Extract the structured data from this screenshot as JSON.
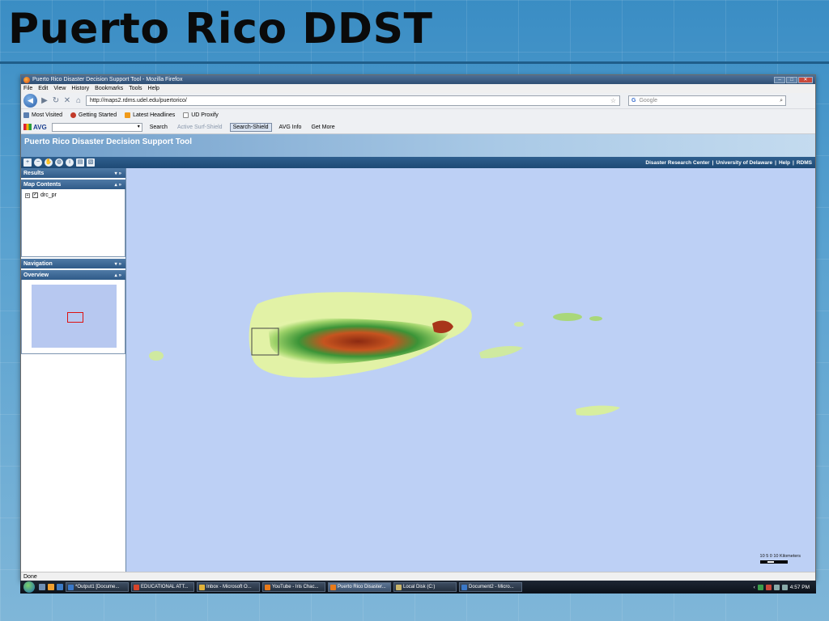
{
  "slide": {
    "title": "Puerto Rico DDST"
  },
  "browser": {
    "window_title": "Puerto Rico Disaster Decision Support Tool - Mozilla Firefox",
    "menu": [
      "File",
      "Edit",
      "View",
      "History",
      "Bookmarks",
      "Tools",
      "Help"
    ],
    "url": "http://maps2.rdms.udel.edu/puertorico/",
    "search_placeholder": "Google",
    "bookmarks": [
      "Most Visited",
      "Getting Started",
      "Latest Headlines",
      "UD Proxify"
    ],
    "avg_toolbar": {
      "logo": "AVG",
      "search_label": "Search",
      "active_surf_shield": "Active Surf-Shield",
      "search_shield": "Search-Shield",
      "avg_info": "AVG Info",
      "get_more": "Get More"
    },
    "status": "Done"
  },
  "app": {
    "title": "Puerto Rico Disaster Decision Support Tool",
    "top_links": [
      "Disaster Research Center",
      "|",
      "University of Delaware",
      "|",
      "Help",
      "|",
      "RDMS"
    ],
    "panels": {
      "results": "Results",
      "map_contents": "Map Contents",
      "layer_name": "drc_pr",
      "navigation": "Navigation",
      "overview": "Overview"
    },
    "scale_label": "10  5  0        10 Kilometers"
  },
  "taskbar": {
    "tasks": [
      {
        "label": "*Output1 [Docume...",
        "active": false
      },
      {
        "label": "EDUCATIONAL ATT...",
        "active": false
      },
      {
        "label": "Inbox - Microsoft O...",
        "active": false
      },
      {
        "label": "YouTube - Iris Chac...",
        "active": false
      },
      {
        "label": "Puerto Rico Disaster...",
        "active": true
      },
      {
        "label": "Local Disk (C:)",
        "active": false
      },
      {
        "label": "Document2 - Micro...",
        "active": false
      }
    ],
    "clock": "4:57 PM"
  },
  "colors": {
    "map_water": "#bdd0f5",
    "relief_low": "#d6f0a8",
    "relief_mid": "#3c9a3a",
    "relief_high": "#b5421a",
    "overview_extent": "#dd1111"
  }
}
